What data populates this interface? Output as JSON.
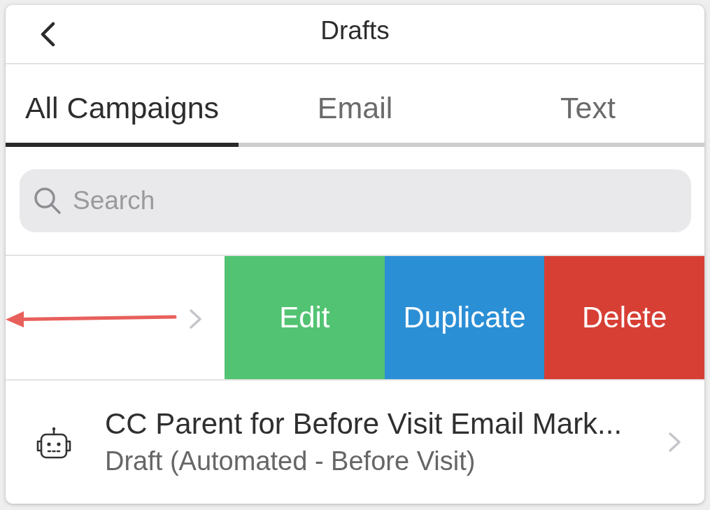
{
  "header": {
    "title": "Drafts"
  },
  "tabs": [
    {
      "label": "All Campaigns",
      "selected": true
    },
    {
      "label": "Email",
      "selected": false
    },
    {
      "label": "Text",
      "selected": false
    }
  ],
  "search": {
    "placeholder": "Search"
  },
  "rows": [
    {
      "kind": "swiped",
      "actions": [
        {
          "label": "Edit",
          "color": "#52c372"
        },
        {
          "label": "Duplicate",
          "color": "#2b8fd6"
        },
        {
          "label": "Delete",
          "color": "#d73f35"
        }
      ]
    },
    {
      "kind": "campaign",
      "title": "CC Parent for Before Visit Email Mark...",
      "subtitle": "Draft (Automated - Before Visit)"
    }
  ]
}
